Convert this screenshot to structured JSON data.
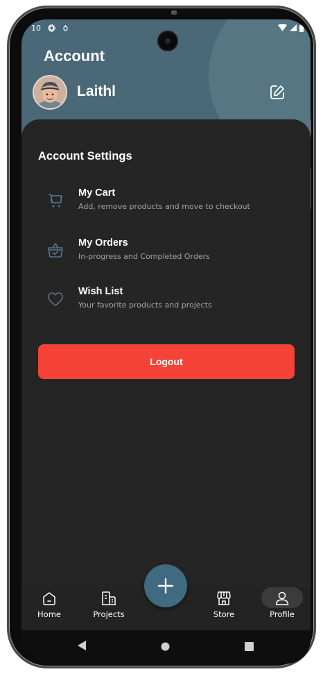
{
  "status_bar": {
    "time": "10",
    "left_icons": [
      "gear-icon",
      "notification-icon"
    ],
    "right_icons": [
      "wifi-icon",
      "signal-icon",
      "battery-icon"
    ]
  },
  "header": {
    "title": "Account",
    "username": "Laithl",
    "avatar_icon": "avatar",
    "edit_icon": "edit-icon"
  },
  "settings": {
    "section_title": "Account Settings",
    "items": [
      {
        "icon": "cart-icon",
        "title": "My Cart",
        "subtitle": "Add, remove products and move to checkout"
      },
      {
        "icon": "orders-icon",
        "title": "My Orders",
        "subtitle": "In-progress and Completed Orders"
      },
      {
        "icon": "heart-icon",
        "title": "Wish List",
        "subtitle": "Your favorite products and projects"
      }
    ]
  },
  "logout_label": "Logout",
  "bottom_nav": {
    "items": [
      {
        "icon": "home-icon",
        "label": "Home"
      },
      {
        "icon": "projects-icon",
        "label": "Projects"
      },
      {
        "icon": "store-icon",
        "label": "Store"
      },
      {
        "icon": "profile-icon",
        "label": "Profile",
        "active": true
      }
    ],
    "fab_icon": "plus-icon"
  },
  "system_nav": [
    "back-icon",
    "home-circle-icon",
    "recents-icon"
  ],
  "colors": {
    "header_bg": "#4a6878",
    "sheet_bg": "#252525",
    "logout_bg": "#f44336",
    "fab_bg": "#3f6a7f",
    "accent_text": "#ffffff"
  }
}
